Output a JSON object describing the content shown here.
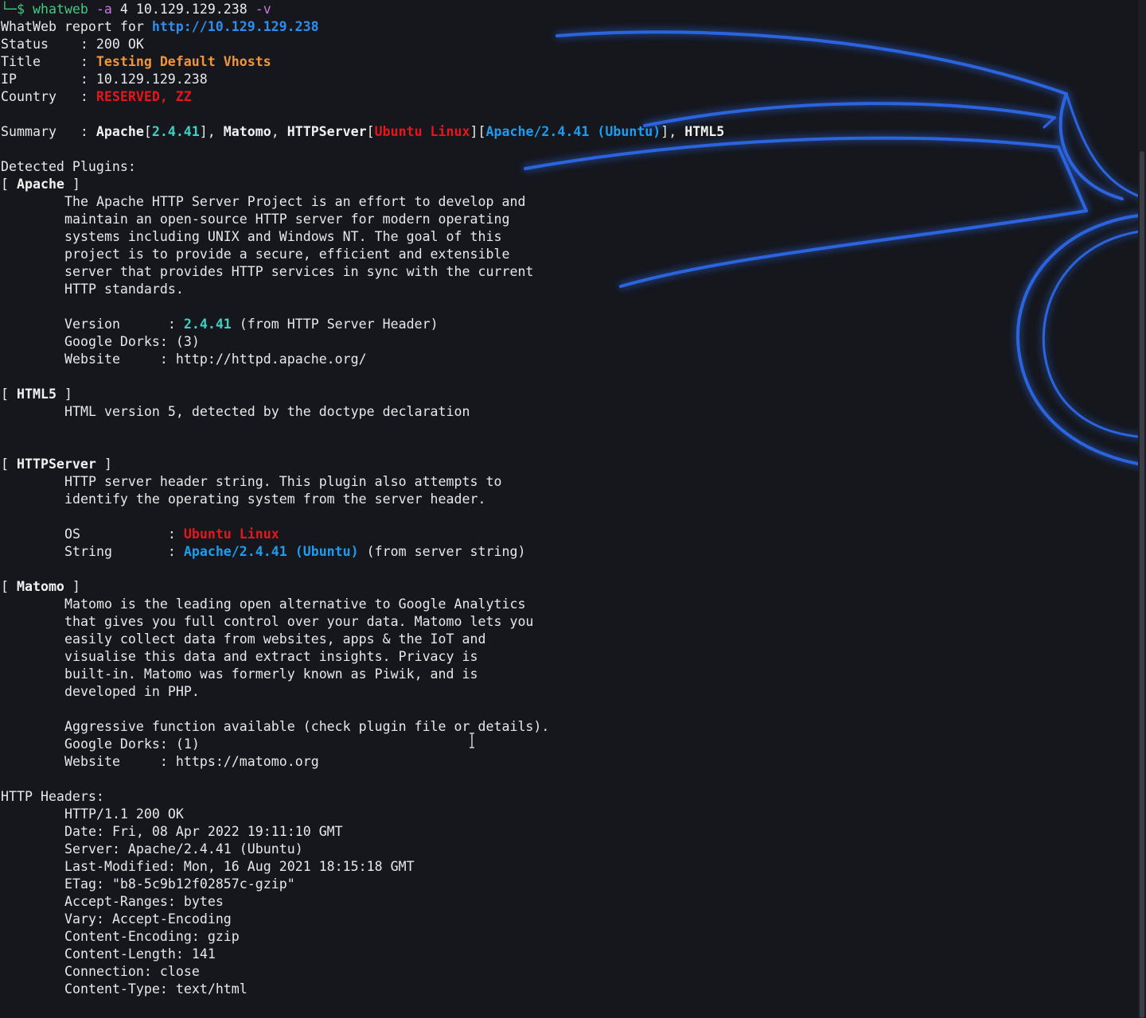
{
  "prompt": {
    "corner": "└─$",
    "command": "whatweb",
    "flag_a": "-a",
    "arg_a": "4",
    "target": "10.129.129.238",
    "flag_v": "-v"
  },
  "report": {
    "heading": "WhatWeb report for",
    "url": "http://10.129.129.238",
    "status_key": "Status",
    "status_val": "200 OK",
    "title_key": "Title",
    "title_val": "Testing Default Vhosts",
    "ip_key": "IP",
    "ip_val": "10.129.129.238",
    "country_key": "Country",
    "country_val": "RESERVED, ZZ",
    "summary_key": "Summary",
    "summary": {
      "apache": "Apache",
      "apache_ver": "2.4.41",
      "matomo": "Matomo",
      "httpserver": "HTTPServer",
      "httpserver_os": "Ubuntu Linux",
      "httpserver_string": "Apache/2.4.41 (Ubuntu)",
      "html5": "HTML5"
    }
  },
  "plugins": {
    "heading": "Detected Plugins:",
    "apache": {
      "name": "Apache",
      "desc": [
        "The Apache HTTP Server Project is an effort to develop and",
        "maintain an open-source HTTP server for modern operating",
        "systems including UNIX and Windows NT. The goal of this",
        "project is to provide a secure, efficient and extensible",
        "server that provides HTTP services in sync with the current",
        "HTTP standards."
      ],
      "version_key": "Version      : ",
      "version_val": "2.4.41",
      "version_note": " (from HTTP Server Header)",
      "dorks": "Google Dorks: (3)",
      "website": "Website     : http://httpd.apache.org/"
    },
    "html5": {
      "name": "HTML5",
      "desc": "HTML version 5, detected by the doctype declaration"
    },
    "httpserver": {
      "name": "HTTPServer",
      "desc": [
        "HTTP server header string. This plugin also attempts to",
        "identify the operating system from the server header."
      ],
      "os_key": "OS           : ",
      "os_val": "Ubuntu Linux",
      "string_key": "String       : ",
      "string_val": "Apache/2.4.41 (Ubuntu)",
      "string_note": " (from server string)"
    },
    "matomo": {
      "name": "Matomo",
      "desc": [
        "Matomo is the leading open alternative to Google Analytics",
        "that gives you full control over your data. Matomo lets you",
        "easily collect data from websites, apps & the IoT and",
        "visualise this data and extract insights. Privacy is",
        "built-in. Matomo was formerly known as Piwik, and is",
        "developed in PHP."
      ],
      "aggressive": "Aggressive function available (check plugin file or details).",
      "dorks": "Google Dorks: (1)",
      "website": "Website     : https://matomo.org"
    }
  },
  "headers": {
    "heading": "HTTP Headers:",
    "lines": [
      "HTTP/1.1 200 OK",
      "Date: Fri, 08 Apr 2022 19:11:10 GMT",
      "Server: Apache/2.4.41 (Ubuntu)",
      "Last-Modified: Mon, 16 Aug 2021 18:15:18 GMT",
      "ETag: \"b8-5c9b12f02857c-gzip\"",
      "Accept-Ranges: bytes",
      "Vary: Accept-Encoding",
      "Content-Encoding: gzip",
      "Content-Length: 141",
      "Connection: close",
      "Content-Type: text/html"
    ]
  },
  "colors": {
    "background": "#15171d",
    "dragon": "#2f6df5",
    "red": "#e5161c",
    "orange": "#f0963a",
    "cyan": "#3fd0c3",
    "blue": "#1f9cf0"
  },
  "icons": {
    "wallpaper": "kali-dragon-logo",
    "cursor": "i-beam-cursor"
  }
}
